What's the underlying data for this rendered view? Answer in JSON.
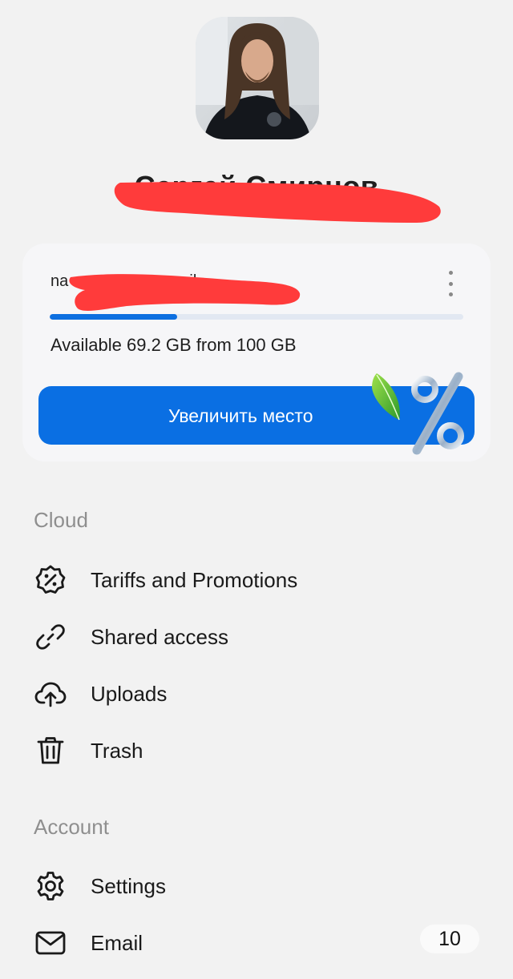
{
  "profile": {
    "name": "Сергей Смирнов",
    "avatar_alt": "avatar"
  },
  "storage": {
    "email_visible": "na",
    "email_tail": "il",
    "used_fraction": 0.308,
    "available_text": "Available 69.2 GB from 100 GB",
    "upgrade_button": "Увеличить место",
    "more_icon": "kebab-icon"
  },
  "sections": {
    "cloud": {
      "title": "Cloud",
      "items": [
        {
          "label": "Tariffs and Promotions",
          "icon": "percent-badge-icon"
        },
        {
          "label": "Shared access",
          "icon": "link-icon"
        },
        {
          "label": "Uploads",
          "icon": "cloud-upload-icon"
        },
        {
          "label": "Trash",
          "icon": "trash-icon"
        }
      ]
    },
    "account": {
      "title": "Account",
      "items": [
        {
          "label": "Settings",
          "icon": "gear-icon"
        },
        {
          "label": "Email",
          "icon": "mail-icon",
          "badge": "10"
        }
      ]
    }
  },
  "colors": {
    "accent": "#0a6fe3",
    "redaction": "#ff3b3b"
  }
}
